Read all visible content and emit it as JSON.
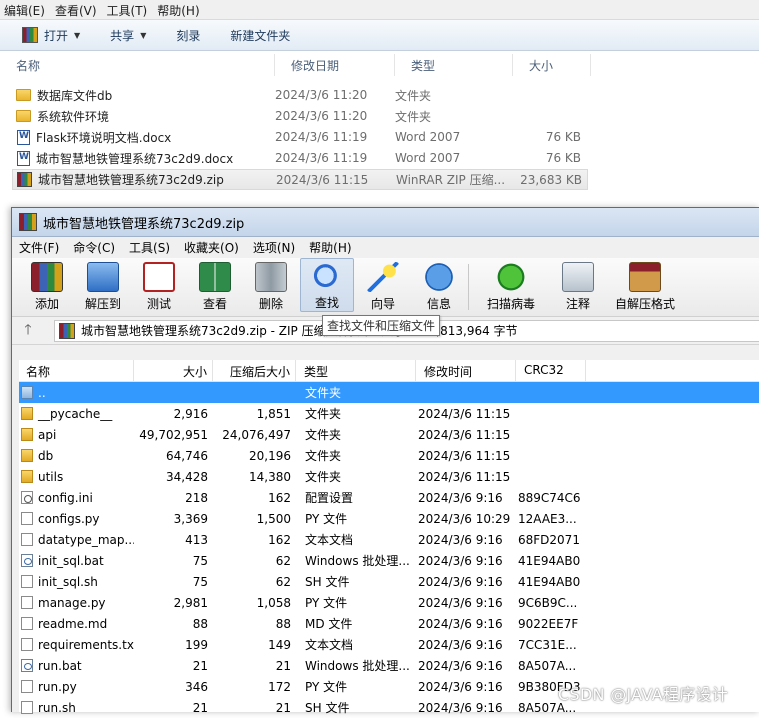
{
  "explorer": {
    "menu": [
      "编辑(E)",
      "查看(V)",
      "工具(T)",
      "帮助(H)"
    ],
    "commands": [
      {
        "label": "打开",
        "icon": "winrar-icon",
        "dropdown": true
      },
      {
        "label": "共享",
        "icon": "",
        "dropdown": true
      },
      {
        "label": "刻录",
        "icon": "",
        "dropdown": false
      },
      {
        "label": "新建文件夹",
        "icon": "",
        "dropdown": false
      }
    ],
    "columns": [
      "名称",
      "修改日期",
      "类型",
      "大小"
    ],
    "files": [
      {
        "name": "数据库文件db",
        "date": "2024/3/6 11:20",
        "type": "文件夹",
        "size": "",
        "icon": "folder-icon"
      },
      {
        "name": "系统软件环境",
        "date": "2024/3/6 11:20",
        "type": "文件夹",
        "size": "",
        "icon": "folder-icon"
      },
      {
        "name": "Flask环境说明文档.docx",
        "date": "2024/3/6 11:19",
        "type": "Word 2007",
        "size": "76 KB",
        "icon": "word-doc-icon"
      },
      {
        "name": "城市智慧地铁管理系统73c2d9.docx",
        "date": "2024/3/6 11:19",
        "type": "Word 2007",
        "size": "76 KB",
        "icon": "word-doc-icon"
      },
      {
        "name": "城市智慧地铁管理系统73c2d9.zip",
        "date": "2024/3/6 11:15",
        "type": "WinRAR ZIP 压缩...",
        "size": "23,683 KB",
        "icon": "winrar-zip-icon",
        "selected": true
      }
    ]
  },
  "winrar": {
    "title": "城市智慧地铁管理系统73c2d9.zip",
    "menu": [
      "文件(F)",
      "命令(C)",
      "工具(S)",
      "收藏夹(O)",
      "选项(N)",
      "帮助(H)"
    ],
    "toolbar": [
      {
        "label": "添加",
        "icon": "add-archive-icon"
      },
      {
        "label": "解压到",
        "icon": "extract-to-icon"
      },
      {
        "label": "测试",
        "icon": "test-icon"
      },
      {
        "label": "查看",
        "icon": "view-book-icon"
      },
      {
        "label": "删除",
        "icon": "trash-icon"
      },
      {
        "label": "查找",
        "icon": "magnifier-icon",
        "pressed": true
      },
      {
        "label": "向导",
        "icon": "wizard-wand-icon"
      },
      {
        "label": "信息",
        "icon": "info-icon"
      },
      {
        "label": "扫描病毒",
        "icon": "virus-scan-icon"
      },
      {
        "label": "注释",
        "icon": "comment-icon"
      },
      {
        "label": "自解压格式",
        "icon": "sfx-box-icon"
      }
    ],
    "tooltip": "查找文件和压缩文件",
    "address": "城市智慧地铁管理系统73c2d9.zip - ZIP 压缩文件, 解包大小为 49,813,964 字节",
    "columns": [
      "名称",
      "大小",
      "压缩后大小",
      "类型",
      "修改时间",
      "CRC32"
    ],
    "rows": [
      {
        "name": "..",
        "size": "",
        "packed": "",
        "type": "文件夹",
        "modified": "",
        "crc": "",
        "icon": "up-folder",
        "selected": true
      },
      {
        "name": "__pycache__",
        "size": "2,916",
        "packed": "1,851",
        "type": "文件夹",
        "modified": "2024/3/6 11:15",
        "crc": "",
        "icon": "folder"
      },
      {
        "name": "api",
        "size": "49,702,951",
        "packed": "24,076,497",
        "type": "文件夹",
        "modified": "2024/3/6 11:15",
        "crc": "",
        "icon": "folder"
      },
      {
        "name": "db",
        "size": "64,746",
        "packed": "20,196",
        "type": "文件夹",
        "modified": "2024/3/6 11:15",
        "crc": "",
        "icon": "folder"
      },
      {
        "name": "utils",
        "size": "34,428",
        "packed": "14,380",
        "type": "文件夹",
        "modified": "2024/3/6 11:15",
        "crc": "",
        "icon": "folder"
      },
      {
        "name": "config.ini",
        "size": "218",
        "packed": "162",
        "type": "配置设置",
        "modified": "2024/3/6 9:16",
        "crc": "889C74C6",
        "icon": "gear"
      },
      {
        "name": "configs.py",
        "size": "3,369",
        "packed": "1,500",
        "type": "PY 文件",
        "modified": "2024/3/6 10:29",
        "crc": "12AAE3...",
        "icon": "file"
      },
      {
        "name": "datatype_map....",
        "size": "413",
        "packed": "162",
        "type": "文本文档",
        "modified": "2024/3/6 9:16",
        "crc": "68FD2071",
        "icon": "file"
      },
      {
        "name": "init_sql.bat",
        "size": "75",
        "packed": "62",
        "type": "Windows 批处理...",
        "modified": "2024/3/6 9:16",
        "crc": "41E94AB0",
        "icon": "bat"
      },
      {
        "name": "init_sql.sh",
        "size": "75",
        "packed": "62",
        "type": "SH 文件",
        "modified": "2024/3/6 9:16",
        "crc": "41E94AB0",
        "icon": "file"
      },
      {
        "name": "manage.py",
        "size": "2,981",
        "packed": "1,058",
        "type": "PY 文件",
        "modified": "2024/3/6 9:16",
        "crc": "9C6B9C...",
        "icon": "file"
      },
      {
        "name": "readme.md",
        "size": "88",
        "packed": "88",
        "type": "MD 文件",
        "modified": "2024/3/6 9:16",
        "crc": "9022EE7F",
        "icon": "file"
      },
      {
        "name": "requirements.txt",
        "size": "199",
        "packed": "149",
        "type": "文本文档",
        "modified": "2024/3/6 9:16",
        "crc": "7CC31E...",
        "icon": "file"
      },
      {
        "name": "run.bat",
        "size": "21",
        "packed": "21",
        "type": "Windows 批处理...",
        "modified": "2024/3/6 9:16",
        "crc": "8A507A...",
        "icon": "bat"
      },
      {
        "name": "run.py",
        "size": "346",
        "packed": "172",
        "type": "PY 文件",
        "modified": "2024/3/6 9:16",
        "crc": "9B380FD3",
        "icon": "file"
      },
      {
        "name": "run.sh",
        "size": "21",
        "packed": "21",
        "type": "SH 文件",
        "modified": "2024/3/6 9:16",
        "crc": "8A507A...",
        "icon": "file"
      }
    ]
  },
  "watermark": "CSDN @JAVA程序设计"
}
